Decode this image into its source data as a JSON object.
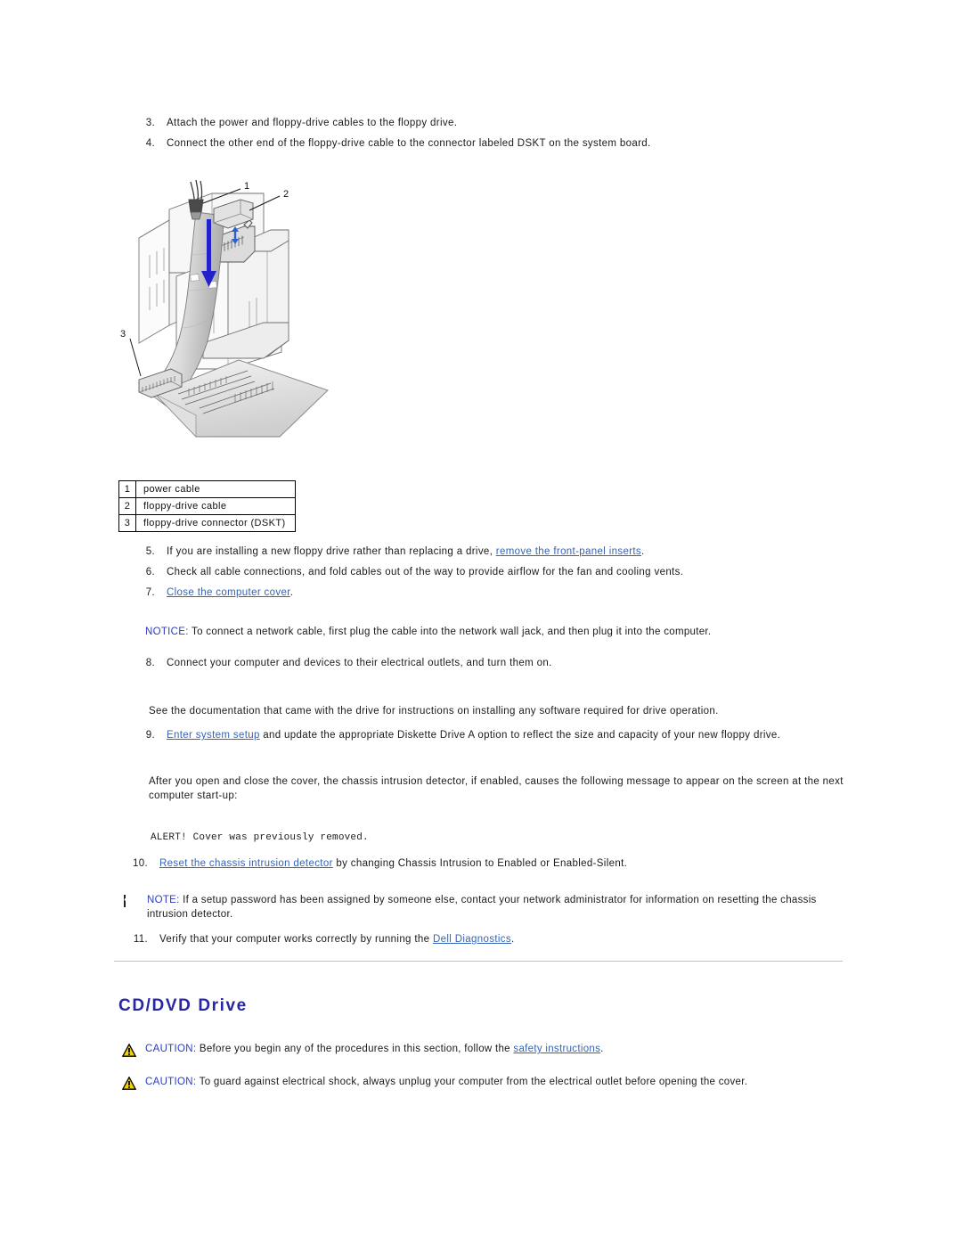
{
  "document": {
    "section_heading": "CD/DVD Drive"
  },
  "steps_top": [
    {
      "number": "3.",
      "text": "Attach the power and floppy-drive cables to the floppy drive."
    },
    {
      "number": "4.",
      "text": "Connect the other end of the floppy-drive cable to the connector labeled DSKT on the system board."
    }
  ],
  "figure": {
    "alt": "Exploded view of floppy drive showing power cable, floppy-drive cable and system board DSKT connector",
    "callouts": [
      "1",
      "2",
      "3"
    ],
    "arrow_color": "#2222cc"
  },
  "legend": {
    "rows": [
      {
        "key": "1",
        "label": "power cable"
      },
      {
        "key": "2",
        "label": "floppy-drive cable"
      },
      {
        "key": "3",
        "label": "floppy-drive connector (DSKT)"
      }
    ]
  },
  "steps_mid": [
    {
      "number": "5.",
      "pre": "If you are installing a new floppy drive rather than replacing a drive, ",
      "link": "remove the front-panel inserts",
      "post": "."
    },
    {
      "number": "6.",
      "pre": "Check all cable connections, and fold cables out of the way to provide airflow for the fan and cooling vents.",
      "link": "",
      "post": ""
    },
    {
      "number": "7.",
      "pre": "",
      "link": "Close the computer cover",
      "post": "."
    }
  ],
  "notice": {
    "icon": "notice-arrow-icon",
    "keyword": "NOTICE:",
    "text": " To connect a network cable, first plug the cable into the network wall jack, and then plug it into the computer."
  },
  "step_8": {
    "number": "8.",
    "text": "Connect your computer and devices to their electrical outlets, and turn them on."
  },
  "paragraph_drive_docs": "See the documentation that came with the drive for instructions on installing any software required for drive operation.",
  "step_9": {
    "number": "9.",
    "link": "Enter system setup",
    "post": " and update the appropriate Diskette Drive A option to reflect the size and capacity of your new floppy drive."
  },
  "paragraph_intrusion": "After you open and close the cover, the chassis intrusion detector, if enabled, causes the following message to appear on the screen at the next computer start-up:",
  "alert_message": "ALERT! Cover was previously removed.",
  "step_10": {
    "number": "10.",
    "link": "Reset the chassis intrusion detector",
    "post": " by changing Chassis Intrusion to Enabled or Enabled-Silent."
  },
  "note": {
    "icon": "note-pencil-icon",
    "keyword": "NOTE:",
    "text": " If a setup password has been assigned by someone else, contact your network administrator for information on resetting the chassis intrusion detector."
  },
  "step_11": {
    "number": "11.",
    "pre": "Verify that your computer works correctly by running the ",
    "link": "Dell Diagnostics",
    "post": "."
  },
  "cautions": [
    {
      "icon": "caution-triangle-icon",
      "keyword": "CAUTION:",
      "pre": " Before you begin any of the procedures in this section, follow the ",
      "link": "safety instructions",
      "post": "."
    },
    {
      "icon": "caution-triangle-icon",
      "keyword": "CAUTION:",
      "pre": " To guard against electrical shock, always unplug your computer from the electrical outlet before opening the cover.",
      "link": "",
      "post": ""
    }
  ],
  "colors": {
    "link": "#3764b4",
    "heading": "#2727a0",
    "keyword": "#2b3cc4",
    "divider": "#bfbfbf",
    "caution_triangle": "#f5d000"
  }
}
